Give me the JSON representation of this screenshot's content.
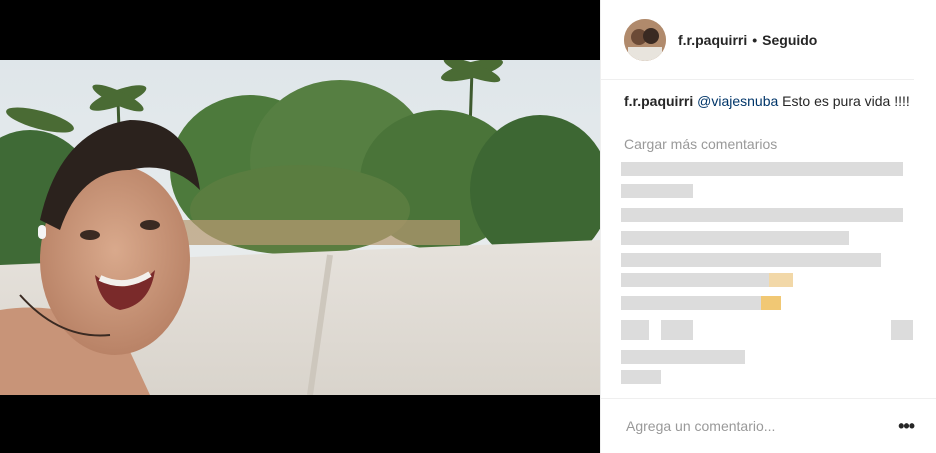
{
  "post": {
    "author": "f.r.paquirri",
    "separator": "•",
    "follow_status": "Seguido",
    "caption_user": "f.r.paquirri",
    "caption_mention": "@viajesnuba",
    "caption_text": " Esto es pura vida !!!!"
  },
  "comments": {
    "load_more_label": "Cargar más comentarios"
  },
  "footer": {
    "comment_placeholder": "Agrega un comentario...",
    "more_icon": "•••"
  },
  "icons": {
    "more": "more-options-icon",
    "avatar": "profile-avatar"
  }
}
